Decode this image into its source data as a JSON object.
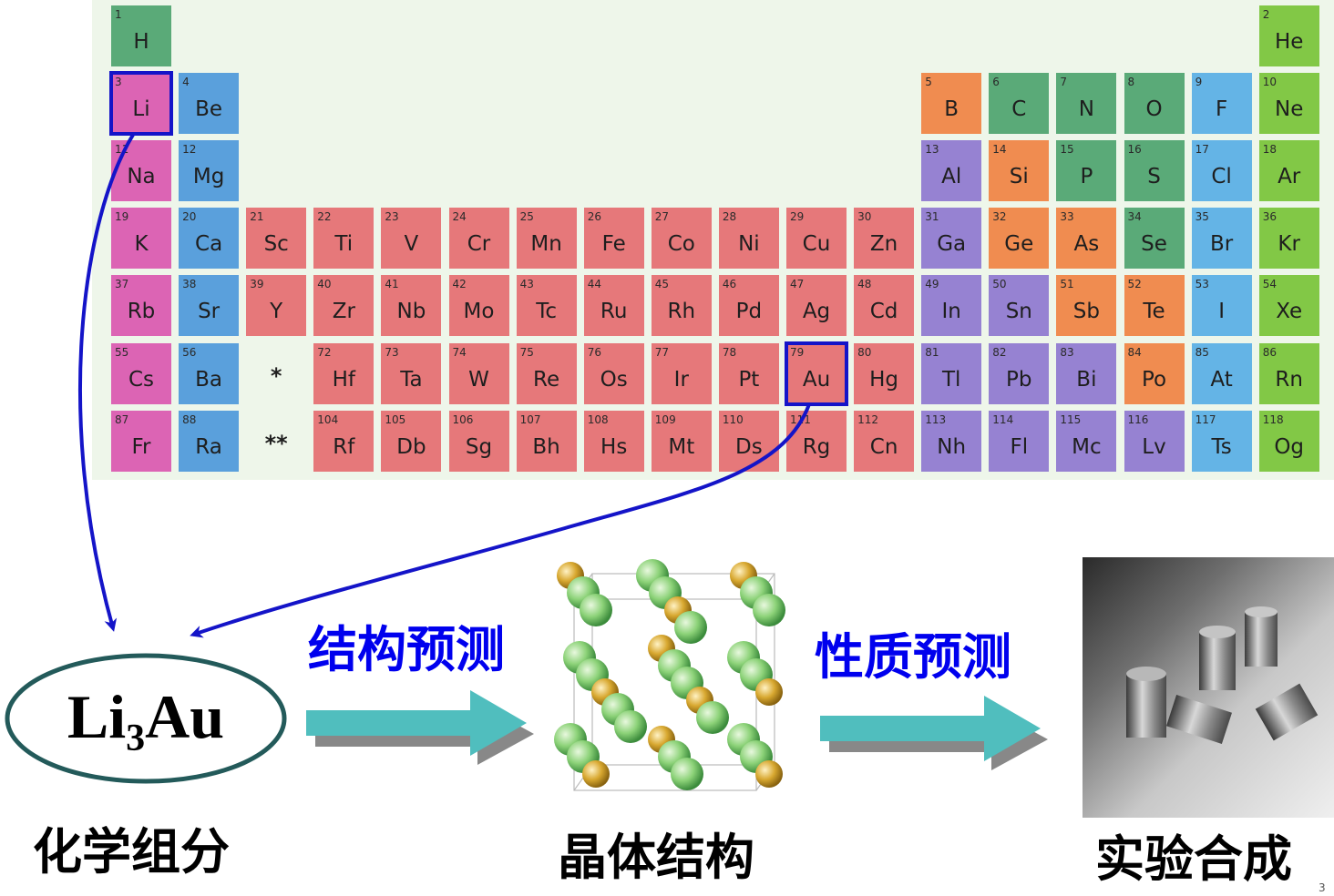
{
  "elements": [
    {
      "n": "1",
      "s": "H",
      "r": 1,
      "c": 1,
      "cat": "nonmetal"
    },
    {
      "n": "2",
      "s": "He",
      "r": 1,
      "c": 18,
      "cat": "noble"
    },
    {
      "n": "3",
      "s": "Li",
      "r": 2,
      "c": 1,
      "cat": "alkali"
    },
    {
      "n": "4",
      "s": "Be",
      "r": 2,
      "c": 2,
      "cat": "alkaline"
    },
    {
      "n": "5",
      "s": "B",
      "r": 2,
      "c": 13,
      "cat": "metalloid"
    },
    {
      "n": "6",
      "s": "C",
      "r": 2,
      "c": 14,
      "cat": "nonmetal"
    },
    {
      "n": "7",
      "s": "N",
      "r": 2,
      "c": 15,
      "cat": "nonmetal"
    },
    {
      "n": "8",
      "s": "O",
      "r": 2,
      "c": 16,
      "cat": "nonmetal"
    },
    {
      "n": "9",
      "s": "F",
      "r": 2,
      "c": 17,
      "cat": "halogen"
    },
    {
      "n": "10",
      "s": "Ne",
      "r": 2,
      "c": 18,
      "cat": "noble"
    },
    {
      "n": "11",
      "s": "Na",
      "r": 3,
      "c": 1,
      "cat": "alkali"
    },
    {
      "n": "12",
      "s": "Mg",
      "r": 3,
      "c": 2,
      "cat": "alkaline"
    },
    {
      "n": "13",
      "s": "Al",
      "r": 3,
      "c": 13,
      "cat": "post"
    },
    {
      "n": "14",
      "s": "Si",
      "r": 3,
      "c": 14,
      "cat": "metalloid"
    },
    {
      "n": "15",
      "s": "P",
      "r": 3,
      "c": 15,
      "cat": "nonmetal"
    },
    {
      "n": "16",
      "s": "S",
      "r": 3,
      "c": 16,
      "cat": "nonmetal"
    },
    {
      "n": "17",
      "s": "Cl",
      "r": 3,
      "c": 17,
      "cat": "halogen"
    },
    {
      "n": "18",
      "s": "Ar",
      "r": 3,
      "c": 18,
      "cat": "noble"
    },
    {
      "n": "19",
      "s": "K",
      "r": 4,
      "c": 1,
      "cat": "alkali"
    },
    {
      "n": "20",
      "s": "Ca",
      "r": 4,
      "c": 2,
      "cat": "alkaline"
    },
    {
      "n": "21",
      "s": "Sc",
      "r": 4,
      "c": 3,
      "cat": "transition"
    },
    {
      "n": "22",
      "s": "Ti",
      "r": 4,
      "c": 4,
      "cat": "transition"
    },
    {
      "n": "23",
      "s": "V",
      "r": 4,
      "c": 5,
      "cat": "transition"
    },
    {
      "n": "24",
      "s": "Cr",
      "r": 4,
      "c": 6,
      "cat": "transition"
    },
    {
      "n": "25",
      "s": "Mn",
      "r": 4,
      "c": 7,
      "cat": "transition"
    },
    {
      "n": "26",
      "s": "Fe",
      "r": 4,
      "c": 8,
      "cat": "transition"
    },
    {
      "n": "27",
      "s": "Co",
      "r": 4,
      "c": 9,
      "cat": "transition"
    },
    {
      "n": "28",
      "s": "Ni",
      "r": 4,
      "c": 10,
      "cat": "transition"
    },
    {
      "n": "29",
      "s": "Cu",
      "r": 4,
      "c": 11,
      "cat": "transition"
    },
    {
      "n": "30",
      "s": "Zn",
      "r": 4,
      "c": 12,
      "cat": "transition"
    },
    {
      "n": "31",
      "s": "Ga",
      "r": 4,
      "c": 13,
      "cat": "post"
    },
    {
      "n": "32",
      "s": "Ge",
      "r": 4,
      "c": 14,
      "cat": "metalloid"
    },
    {
      "n": "33",
      "s": "As",
      "r": 4,
      "c": 15,
      "cat": "metalloid"
    },
    {
      "n": "34",
      "s": "Se",
      "r": 4,
      "c": 16,
      "cat": "nonmetal"
    },
    {
      "n": "35",
      "s": "Br",
      "r": 4,
      "c": 17,
      "cat": "halogen"
    },
    {
      "n": "36",
      "s": "Kr",
      "r": 4,
      "c": 18,
      "cat": "noble"
    },
    {
      "n": "37",
      "s": "Rb",
      "r": 5,
      "c": 1,
      "cat": "alkali"
    },
    {
      "n": "38",
      "s": "Sr",
      "r": 5,
      "c": 2,
      "cat": "alkaline"
    },
    {
      "n": "39",
      "s": "Y",
      "r": 5,
      "c": 3,
      "cat": "transition"
    },
    {
      "n": "40",
      "s": "Zr",
      "r": 5,
      "c": 4,
      "cat": "transition"
    },
    {
      "n": "41",
      "s": "Nb",
      "r": 5,
      "c": 5,
      "cat": "transition"
    },
    {
      "n": "42",
      "s": "Mo",
      "r": 5,
      "c": 6,
      "cat": "transition"
    },
    {
      "n": "43",
      "s": "Tc",
      "r": 5,
      "c": 7,
      "cat": "transition"
    },
    {
      "n": "44",
      "s": "Ru",
      "r": 5,
      "c": 8,
      "cat": "transition"
    },
    {
      "n": "45",
      "s": "Rh",
      "r": 5,
      "c": 9,
      "cat": "transition"
    },
    {
      "n": "46",
      "s": "Pd",
      "r": 5,
      "c": 10,
      "cat": "transition"
    },
    {
      "n": "47",
      "s": "Ag",
      "r": 5,
      "c": 11,
      "cat": "transition"
    },
    {
      "n": "48",
      "s": "Cd",
      "r": 5,
      "c": 12,
      "cat": "transition"
    },
    {
      "n": "49",
      "s": "In",
      "r": 5,
      "c": 13,
      "cat": "post"
    },
    {
      "n": "50",
      "s": "Sn",
      "r": 5,
      "c": 14,
      "cat": "post"
    },
    {
      "n": "51",
      "s": "Sb",
      "r": 5,
      "c": 15,
      "cat": "metalloid"
    },
    {
      "n": "52",
      "s": "Te",
      "r": 5,
      "c": 16,
      "cat": "metalloid"
    },
    {
      "n": "53",
      "s": "I",
      "r": 5,
      "c": 17,
      "cat": "halogen"
    },
    {
      "n": "54",
      "s": "Xe",
      "r": 5,
      "c": 18,
      "cat": "noble"
    },
    {
      "n": "55",
      "s": "Cs",
      "r": 6,
      "c": 1,
      "cat": "alkali"
    },
    {
      "n": "56",
      "s": "Ba",
      "r": 6,
      "c": 2,
      "cat": "alkaline"
    },
    {
      "n": "",
      "s": "*",
      "r": 6,
      "c": 3,
      "cat": "marker"
    },
    {
      "n": "72",
      "s": "Hf",
      "r": 6,
      "c": 4,
      "cat": "transition"
    },
    {
      "n": "73",
      "s": "Ta",
      "r": 6,
      "c": 5,
      "cat": "transition"
    },
    {
      "n": "74",
      "s": "W",
      "r": 6,
      "c": 6,
      "cat": "transition"
    },
    {
      "n": "75",
      "s": "Re",
      "r": 6,
      "c": 7,
      "cat": "transition"
    },
    {
      "n": "76",
      "s": "Os",
      "r": 6,
      "c": 8,
      "cat": "transition"
    },
    {
      "n": "77",
      "s": "Ir",
      "r": 6,
      "c": 9,
      "cat": "transition"
    },
    {
      "n": "78",
      "s": "Pt",
      "r": 6,
      "c": 10,
      "cat": "transition"
    },
    {
      "n": "79",
      "s": "Au",
      "r": 6,
      "c": 11,
      "cat": "transition"
    },
    {
      "n": "80",
      "s": "Hg",
      "r": 6,
      "c": 12,
      "cat": "transition"
    },
    {
      "n": "81",
      "s": "Tl",
      "r": 6,
      "c": 13,
      "cat": "post"
    },
    {
      "n": "82",
      "s": "Pb",
      "r": 6,
      "c": 14,
      "cat": "post"
    },
    {
      "n": "83",
      "s": "Bi",
      "r": 6,
      "c": 15,
      "cat": "post"
    },
    {
      "n": "84",
      "s": "Po",
      "r": 6,
      "c": 16,
      "cat": "metalloid"
    },
    {
      "n": "85",
      "s": "At",
      "r": 6,
      "c": 17,
      "cat": "halogen"
    },
    {
      "n": "86",
      "s": "Rn",
      "r": 6,
      "c": 18,
      "cat": "noble"
    },
    {
      "n": "87",
      "s": "Fr",
      "r": 7,
      "c": 1,
      "cat": "alkali"
    },
    {
      "n": "88",
      "s": "Ra",
      "r": 7,
      "c": 2,
      "cat": "alkaline"
    },
    {
      "n": "",
      "s": "**",
      "r": 7,
      "c": 3,
      "cat": "marker"
    },
    {
      "n": "104",
      "s": "Rf",
      "r": 7,
      "c": 4,
      "cat": "transition"
    },
    {
      "n": "105",
      "s": "Db",
      "r": 7,
      "c": 5,
      "cat": "transition"
    },
    {
      "n": "106",
      "s": "Sg",
      "r": 7,
      "c": 6,
      "cat": "transition"
    },
    {
      "n": "107",
      "s": "Bh",
      "r": 7,
      "c": 7,
      "cat": "transition"
    },
    {
      "n": "108",
      "s": "Hs",
      "r": 7,
      "c": 8,
      "cat": "transition"
    },
    {
      "n": "109",
      "s": "Mt",
      "r": 7,
      "c": 9,
      "cat": "transition"
    },
    {
      "n": "110",
      "s": "Ds",
      "r": 7,
      "c": 10,
      "cat": "transition"
    },
    {
      "n": "111",
      "s": "Rg",
      "r": 7,
      "c": 11,
      "cat": "transition"
    },
    {
      "n": "112",
      "s": "Cn",
      "r": 7,
      "c": 12,
      "cat": "transition"
    },
    {
      "n": "113",
      "s": "Nh",
      "r": 7,
      "c": 13,
      "cat": "post"
    },
    {
      "n": "114",
      "s": "Fl",
      "r": 7,
      "c": 14,
      "cat": "post"
    },
    {
      "n": "115",
      "s": "Mc",
      "r": 7,
      "c": 15,
      "cat": "post"
    },
    {
      "n": "116",
      "s": "Lv",
      "r": 7,
      "c": 16,
      "cat": "post"
    },
    {
      "n": "117",
      "s": "Ts",
      "r": 7,
      "c": 17,
      "cat": "halogen"
    },
    {
      "n": "118",
      "s": "Og",
      "r": 7,
      "c": 18,
      "cat": "noble"
    }
  ],
  "highlighted": [
    "Li",
    "Au"
  ],
  "colors": {
    "nonmetal": "#5aaa78",
    "noble": "#82c846",
    "alkali": "#dc64b4",
    "alkaline": "#5aa0dc",
    "metalloid": "#f08c50",
    "halogen": "#64b4e6",
    "post": "#9682d2",
    "transition": "#e6787a",
    "marker": "transparent",
    "highlight_border": "#1414c8",
    "flow_arrow": "#50bebe",
    "li_atom": "#8cd278",
    "au_atom": "#c8a028",
    "label_blue": "#0000ee"
  },
  "formula": {
    "base": "Li",
    "sub": "3",
    "rest": "Au"
  },
  "labels": {
    "structure_prediction": "结构预测",
    "property_prediction": "性质预测"
  },
  "captions": {
    "composition": "化学组分",
    "crystal": "晶体结构",
    "synthesis": "实验合成"
  },
  "page_number": "3"
}
